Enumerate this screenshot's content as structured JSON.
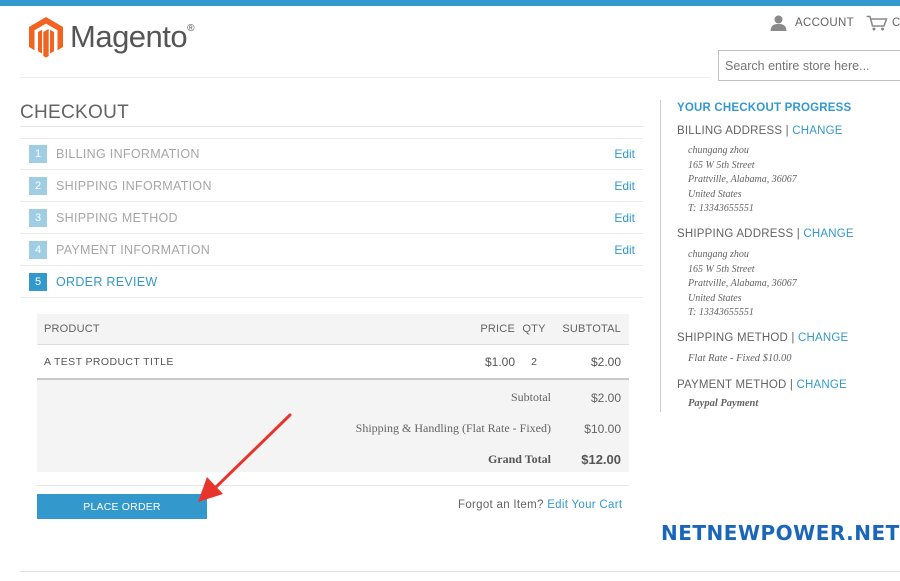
{
  "header": {
    "logo_text": "Magento",
    "logo_mark": "®",
    "account_label": "ACCOUNT",
    "cart_label": "C",
    "search_placeholder": "Search entire store here..."
  },
  "checkout": {
    "title": "CHECKOUT",
    "steps": [
      {
        "num": "1",
        "label": "BILLING INFORMATION",
        "edit": "Edit"
      },
      {
        "num": "2",
        "label": "SHIPPING INFORMATION",
        "edit": "Edit"
      },
      {
        "num": "3",
        "label": "SHIPPING METHOD",
        "edit": "Edit"
      },
      {
        "num": "4",
        "label": "PAYMENT INFORMATION",
        "edit": "Edit"
      },
      {
        "num": "5",
        "label": "ORDER REVIEW"
      }
    ]
  },
  "review": {
    "columns": {
      "product": "PRODUCT",
      "price": "PRICE",
      "qty": "QTY",
      "subtotal": "SUBTOTAL"
    },
    "items": [
      {
        "product": "A TEST PRODUCT TITLE",
        "price": "$1.00",
        "qty": "2",
        "subtotal": "$2.00"
      }
    ],
    "totals": [
      {
        "label": "Subtotal",
        "value": "$2.00"
      },
      {
        "label": "Shipping & Handling (Flat Rate - Fixed)",
        "value": "$10.00"
      },
      {
        "label": "Grand Total",
        "value": "$12.00"
      }
    ],
    "place_order_label": "PLACE ORDER",
    "forgot_text": "Forgot an Item?",
    "edit_cart_link": "Edit Your Cart"
  },
  "sidebar": {
    "title": "YOUR CHECKOUT PROGRESS",
    "change_label": "CHANGE",
    "billing_title": "BILLING ADDRESS",
    "billing_lines": [
      "chungang zhou",
      "165 W 5th Street",
      "Prattville, Alabama, 36067",
      "United States",
      "T: 13343655551"
    ],
    "shipping_title": "SHIPPING ADDRESS",
    "shipping_lines": [
      "chungang zhou",
      "165 W 5th Street",
      "Prattville, Alabama, 36067",
      "United States",
      "T: 13343655551"
    ],
    "method_title": "SHIPPING METHOD",
    "method_value": "Flat Rate - Fixed $10.00",
    "payment_title": "PAYMENT METHOD",
    "payment_value": "Paypal Payment"
  },
  "watermark": "NETNEWPOWER.NET",
  "colors": {
    "accent": "#3399cc",
    "watermark": "#1a66b8",
    "logo_orange": "#f26322"
  }
}
